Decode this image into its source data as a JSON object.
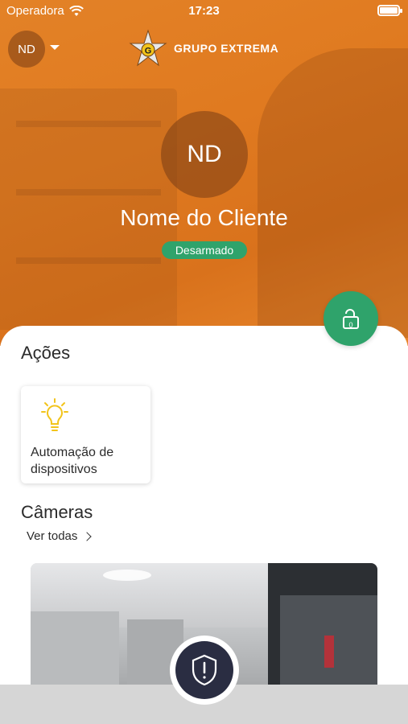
{
  "status_bar": {
    "carrier": "Operadora",
    "time": "17:23"
  },
  "header": {
    "user_initials": "ND",
    "brand_name": "GRUPO EXTREMA",
    "brand_logo_letter": "G"
  },
  "profile": {
    "initials": "ND",
    "client_name": "Nome do Cliente",
    "status": "Desarmado"
  },
  "lock_fab": {
    "count": "0"
  },
  "actions": {
    "title": "Ações",
    "items": [
      {
        "label": "Automação de dispositivos",
        "icon": "lightbulb-icon"
      }
    ]
  },
  "cameras": {
    "title": "Câmeras",
    "see_all": "Ver todas"
  },
  "colors": {
    "primary_orange": "#e38227",
    "armed_status_green": "#2fa36b",
    "panic_navy": "#2a2d42",
    "bulb_yellow": "#f2c41b"
  }
}
